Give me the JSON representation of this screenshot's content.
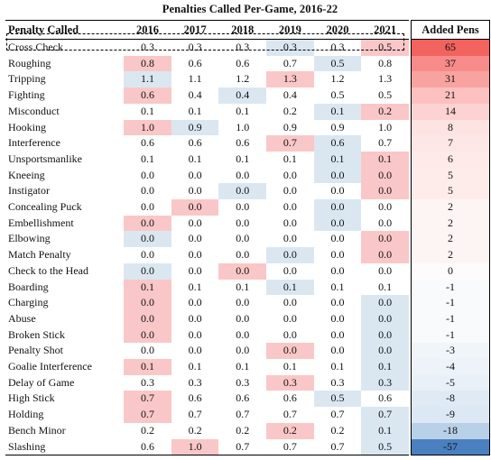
{
  "title": "Penalties Called Per-Game, 2016-22",
  "header": {
    "name_col": "Penalty Called",
    "years": [
      "2016",
      "2017",
      "2018",
      "2019",
      "2020",
      "2021"
    ],
    "added_col": "Added Pens"
  },
  "colors": {
    "highlight_pink": "#fac7c8",
    "highlight_blue": "#dbe7f0",
    "scale_red_max": "#f2625f",
    "scale_blue_min": "#4a80c0",
    "grid_line": "#000000"
  },
  "chart_data": {
    "type": "table",
    "title": "Penalties Called Per-Game, 2016-22",
    "columns": [
      "Penalty Called",
      "2016",
      "2017",
      "2018",
      "2019",
      "2020",
      "2021",
      "Added Pens"
    ],
    "rows": [
      {
        "name": "Cross Check",
        "values": [
          "0.3",
          "0.3",
          "0.3",
          "0.3",
          "0.3",
          "0.5"
        ],
        "hl": [
          "",
          "",
          "",
          "b",
          "",
          "p"
        ],
        "added": "65",
        "added_color": "#f2625f"
      },
      {
        "name": "Roughing",
        "values": [
          "0.8",
          "0.6",
          "0.6",
          "0.7",
          "0.5",
          "0.8"
        ],
        "hl": [
          "p",
          "",
          "",
          "",
          "b",
          ""
        ],
        "added": "37",
        "added_color": "#f78b89"
      },
      {
        "name": "Tripping",
        "values": [
          "1.1",
          "1.1",
          "1.2",
          "1.3",
          "1.2",
          "1.3"
        ],
        "hl": [
          "b",
          "",
          "",
          "p",
          "",
          ""
        ],
        "added": "31",
        "added_color": "#f9a3a1"
      },
      {
        "name": "Fighting",
        "values": [
          "0.6",
          "0.4",
          "0.4",
          "0.4",
          "0.5",
          "0.5"
        ],
        "hl": [
          "p",
          "",
          "b",
          "",
          "",
          ""
        ],
        "added": "21",
        "added_color": "#fbc0bf"
      },
      {
        "name": "Misconduct",
        "values": [
          "0.1",
          "0.1",
          "0.1",
          "0.2",
          "0.1",
          "0.2"
        ],
        "hl": [
          "",
          "",
          "",
          "",
          "b",
          "p"
        ],
        "added": "14",
        "added_color": "#fcd3d2"
      },
      {
        "name": "Hooking",
        "values": [
          "1.0",
          "0.9",
          "1.0",
          "0.9",
          "0.9",
          "1.0"
        ],
        "hl": [
          "p",
          "b",
          "",
          "",
          "",
          ""
        ],
        "added": "8",
        "added_color": "#fde4e3"
      },
      {
        "name": "Interference",
        "values": [
          "0.6",
          "0.6",
          "0.6",
          "0.7",
          "0.6",
          "0.7"
        ],
        "hl": [
          "",
          "",
          "",
          "p",
          "b",
          ""
        ],
        "added": "7",
        "added_color": "#fde7e6"
      },
      {
        "name": "Unsportsmanlike",
        "values": [
          "0.1",
          "0.1",
          "0.1",
          "0.1",
          "0.1",
          "0.1"
        ],
        "hl": [
          "",
          "",
          "",
          "",
          "b",
          "p"
        ],
        "added": "6",
        "added_color": "#fdeae9"
      },
      {
        "name": "Kneeing",
        "values": [
          "0.0",
          "0.0",
          "0.0",
          "0.0",
          "0.0",
          "0.0"
        ],
        "hl": [
          "",
          "",
          "",
          "",
          "b",
          "p"
        ],
        "added": "5",
        "added_color": "#feeceb"
      },
      {
        "name": "Instigator",
        "values": [
          "0.0",
          "0.0",
          "0.0",
          "0.0",
          "0.0",
          "0.0"
        ],
        "hl": [
          "",
          "",
          "b",
          "",
          "",
          "p"
        ],
        "added": "5",
        "added_color": "#feeceb"
      },
      {
        "name": "Concealing Puck",
        "values": [
          "0.0",
          "0.0",
          "0.0",
          "0.0",
          "0.0",
          "0.0"
        ],
        "hl": [
          "",
          "p",
          "",
          "",
          "b",
          ""
        ],
        "added": "2",
        "added_color": "#fdf4f4"
      },
      {
        "name": "Embellishment",
        "values": [
          "0.0",
          "0.0",
          "0.0",
          "0.0",
          "0.0",
          "0.0"
        ],
        "hl": [
          "p",
          "",
          "",
          "",
          "b",
          ""
        ],
        "added": "2",
        "added_color": "#fdf4f4"
      },
      {
        "name": "Elbowing",
        "values": [
          "0.0",
          "0.0",
          "0.0",
          "0.0",
          "0.0",
          "0.0"
        ],
        "hl": [
          "b",
          "",
          "",
          "",
          "",
          "p"
        ],
        "added": "2",
        "added_color": "#fdf4f4"
      },
      {
        "name": "Match Penalty",
        "values": [
          "0.0",
          "0.0",
          "0.0",
          "0.0",
          "0.0",
          "0.0"
        ],
        "hl": [
          "",
          "",
          "",
          "b",
          "",
          "p"
        ],
        "added": "2",
        "added_color": "#fdf4f4"
      },
      {
        "name": "Check to the Head",
        "values": [
          "0.0",
          "0.0",
          "0.0",
          "0.0",
          "0.0",
          "0.0"
        ],
        "hl": [
          "b",
          "",
          "p",
          "",
          "",
          ""
        ],
        "added": "0",
        "added_color": "#fdfbfb"
      },
      {
        "name": "Boarding",
        "values": [
          "0.1",
          "0.1",
          "0.1",
          "0.1",
          "0.1",
          "0.1"
        ],
        "hl": [
          "p",
          "",
          "",
          "b",
          "",
          ""
        ],
        "added": "-1",
        "added_color": "#f8fafc"
      },
      {
        "name": "Charging",
        "values": [
          "0.0",
          "0.0",
          "0.0",
          "0.0",
          "0.0",
          "0.0"
        ],
        "hl": [
          "p",
          "",
          "",
          "",
          "",
          "b"
        ],
        "added": "-1",
        "added_color": "#f8fafc"
      },
      {
        "name": "Abuse",
        "values": [
          "0.0",
          "0.0",
          "0.0",
          "0.0",
          "0.0",
          "0.0"
        ],
        "hl": [
          "p",
          "",
          "",
          "",
          "",
          "b"
        ],
        "added": "-1",
        "added_color": "#f8fafc"
      },
      {
        "name": "Broken Stick",
        "values": [
          "0.0",
          "0.0",
          "0.0",
          "0.0",
          "0.0",
          "0.0"
        ],
        "hl": [
          "p",
          "",
          "",
          "",
          "",
          "b"
        ],
        "added": "-1",
        "added_color": "#f8fafc"
      },
      {
        "name": "Penalty Shot",
        "values": [
          "0.0",
          "0.0",
          "0.0",
          "0.0",
          "0.0",
          "0.0"
        ],
        "hl": [
          "",
          "",
          "",
          "p",
          "",
          "b"
        ],
        "added": "-3",
        "added_color": "#f0f5fa"
      },
      {
        "name": "Goalie Interference",
        "values": [
          "0.1",
          "0.1",
          "0.1",
          "0.1",
          "0.1",
          "0.1"
        ],
        "hl": [
          "p",
          "",
          "",
          "",
          "",
          "b"
        ],
        "added": "-4",
        "added_color": "#edf3f9"
      },
      {
        "name": "Delay of Game",
        "values": [
          "0.3",
          "0.3",
          "0.3",
          "0.3",
          "0.3",
          "0.3"
        ],
        "hl": [
          "",
          "",
          "",
          "p",
          "",
          "b"
        ],
        "added": "-5",
        "added_color": "#e9f0f8"
      },
      {
        "name": "High Stick",
        "values": [
          "0.7",
          "0.6",
          "0.6",
          "0.6",
          "0.5",
          "0.6"
        ],
        "hl": [
          "p",
          "",
          "",
          "",
          "b",
          ""
        ],
        "added": "-8",
        "added_color": "#e0eaf4"
      },
      {
        "name": "Holding",
        "values": [
          "0.7",
          "0.7",
          "0.7",
          "0.7",
          "0.7",
          "0.7"
        ],
        "hl": [
          "p",
          "",
          "",
          "",
          "",
          "b"
        ],
        "added": "-9",
        "added_color": "#dce8f3"
      },
      {
        "name": "Bench Minor",
        "values": [
          "0.2",
          "0.2",
          "0.2",
          "0.2",
          "0.2",
          "0.1"
        ],
        "hl": [
          "",
          "",
          "",
          "p",
          "",
          "b"
        ],
        "added": "-18",
        "added_color": "#b9d0e9"
      },
      {
        "name": "Slashing",
        "values": [
          "0.6",
          "1.0",
          "0.7",
          "0.7",
          "0.7",
          "0.5"
        ],
        "hl": [
          "",
          "p",
          "",
          "",
          "",
          "b"
        ],
        "added": "-57",
        "added_color": "#4a80c0"
      }
    ],
    "legend": {
      "pink_meaning": "row maximum / relatively high",
      "blue_meaning": "row minimum / relatively low"
    },
    "highlighted_row": "Cross Check"
  }
}
